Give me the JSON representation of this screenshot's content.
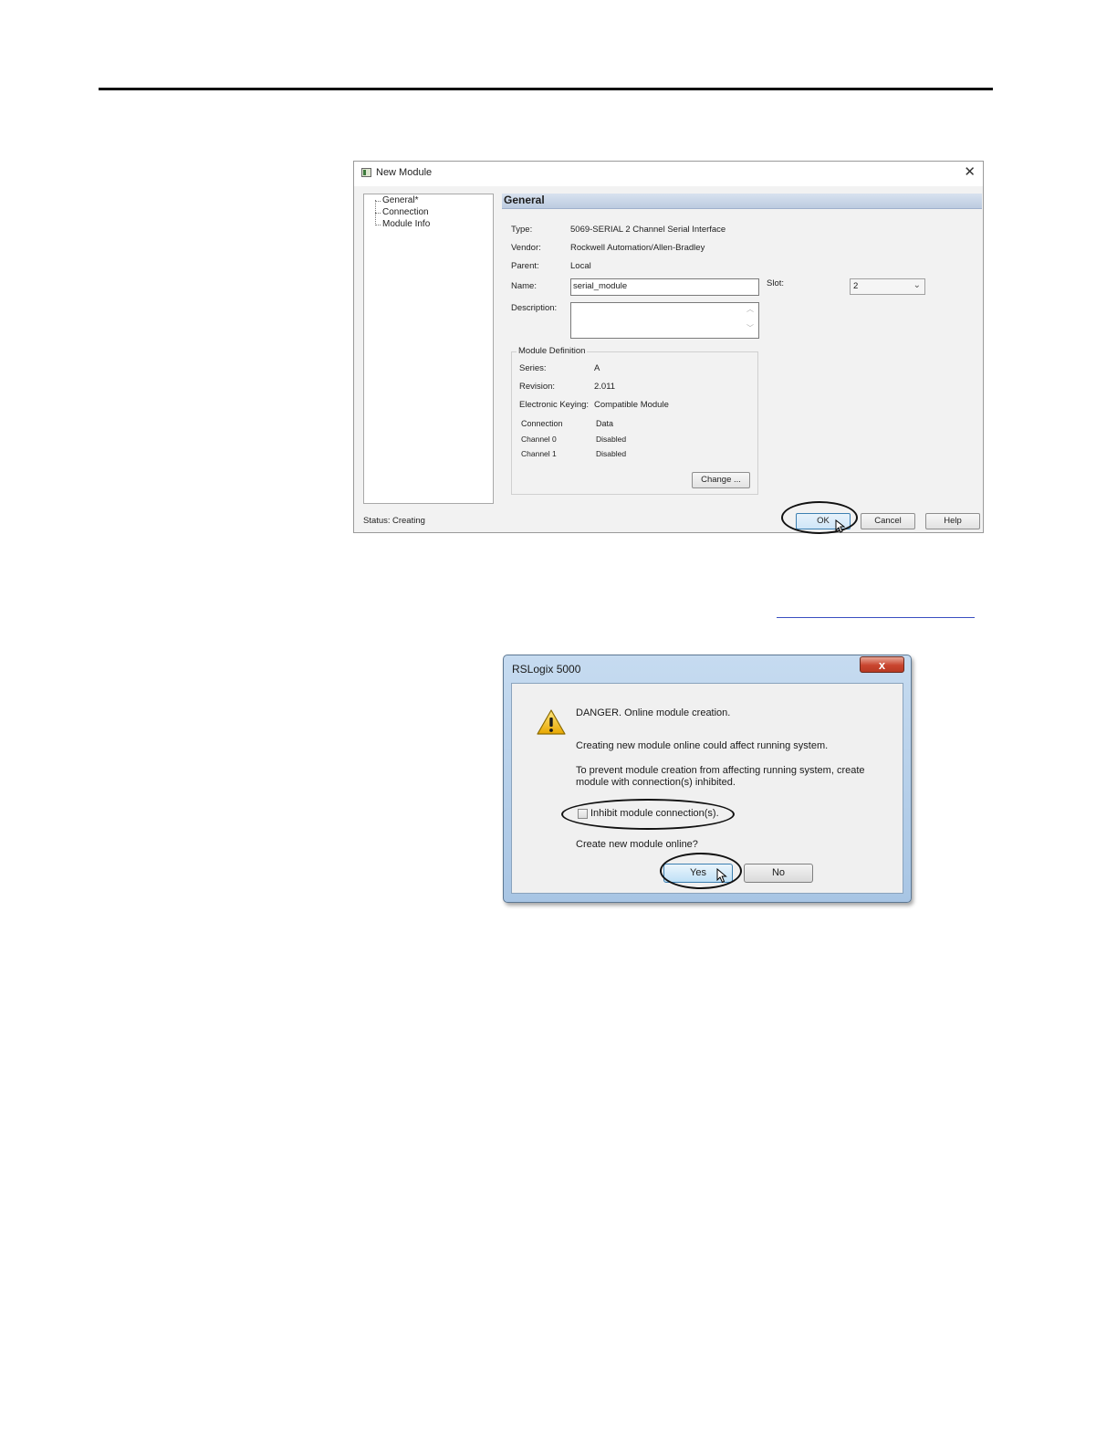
{
  "new_module": {
    "title": "New Module",
    "close": "✕",
    "tree": [
      "General*",
      "Connection",
      "Module Info"
    ],
    "section": "General",
    "type_label": "Type:",
    "type_value": "5069-SERIAL 2 Channel Serial Interface",
    "vendor_label": "Vendor:",
    "vendor_value": "Rockwell Automation/Allen-Bradley",
    "parent_label": "Parent:",
    "parent_value": "Local",
    "name_label": "Name:",
    "name_value": "serial_module",
    "slot_label": "Slot:",
    "slot_value": "2",
    "description_label": "Description:",
    "description_value": "",
    "module_definition": {
      "legend": "Module Definition",
      "series_label": "Series:",
      "series_value": "A",
      "revision_label": "Revision:",
      "revision_value": "2.011",
      "keying_label": "Electronic Keying:",
      "keying_value": "Compatible Module",
      "connection_label": "Connection",
      "connection_value": "Data",
      "channel0_label": "Channel 0",
      "channel0_value": "Disabled",
      "channel1_label": "Channel 1",
      "channel1_value": "Disabled",
      "change_button": "Change ..."
    },
    "status_label": "Status:",
    "status_value": "Creating",
    "ok_button": "OK",
    "cancel_button": "Cancel",
    "help_button": "Help"
  },
  "rslogix_dialog": {
    "title": "RSLogix 5000",
    "close": "x",
    "warning_icon": "!",
    "line1": "DANGER. Online module creation.",
    "line2": "Creating new module online could affect running system.",
    "line3a": "To prevent module creation from affecting running system, create",
    "line3b": "module with connection(s) inhibited.",
    "checkbox_label": "Inhibit module connection(s).",
    "checkbox_checked": false,
    "question": "Create new module online?",
    "yes_button": "Yes",
    "no_button": "No"
  },
  "icons": [
    "app-icon",
    "close-icon",
    "warning-icon",
    "mouse-cursor-icon",
    "dropdown-chevron-icon",
    "scroll-up-icon",
    "scroll-down-icon"
  ]
}
